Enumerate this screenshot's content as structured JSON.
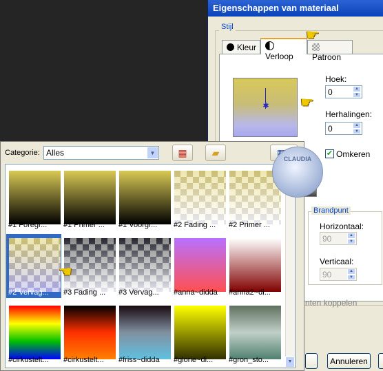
{
  "dialog": {
    "title": "Eigenschappen van materiaal",
    "stijl_label": "Stijl",
    "tabs": [
      {
        "label": "Kleur",
        "icon": "color-dot-icon"
      },
      {
        "label": "Verloop",
        "icon": "gradient-icon"
      },
      {
        "label": "Patroon",
        "icon": "pattern-icon"
      }
    ],
    "active_tab": "Verloop",
    "hoek_label": "Hoek:",
    "hoek_value": "0",
    "herhalingen_label": "Herhalingen:",
    "herhalingen_value": "0",
    "omkeren_label": "Omkeren",
    "omkeren_checked": true,
    "brandpunt_label": "Brandpunt",
    "horizontaal_label": "Horizontaal:",
    "horizontaal_value": "90",
    "verticaal_label": "Verticaal:",
    "verticaal_value": "90",
    "koppelen_label": "nten koppelen",
    "cancel_button": "Annuleren"
  },
  "picker": {
    "category_label": "Categorie:",
    "category_value": "Alles",
    "selected_index": 5,
    "gradients": [
      {
        "name": "#1 Foregr...",
        "colors": [
          "#d9c955",
          "#000000"
        ]
      },
      {
        "name": "#1 Primer ...",
        "colors": [
          "#d9c955",
          "#000000"
        ]
      },
      {
        "name": "#1 Voorgr...",
        "colors": [
          "#d9c955",
          "#000000"
        ]
      },
      {
        "name": "#2 Fading ...",
        "colors": [
          "#d9c955",
          "checker"
        ]
      },
      {
        "name": "#2 Primer ...",
        "colors": [
          "#d9c955",
          "checker"
        ]
      },
      {
        "name": "#2 Vervag...",
        "colors": [
          "#d9c955",
          "#a8a8f0"
        ]
      },
      {
        "name": "#3 Fading ...",
        "colors": [
          "#000000",
          "#ffffff"
        ]
      },
      {
        "name": "#3 Vervag...",
        "colors": [
          "#000000",
          "#ffffff"
        ]
      },
      {
        "name": "#anna~didda",
        "colors": [
          "#b870ff",
          "#ff5050"
        ]
      },
      {
        "name": "#anna2~di...",
        "colors": [
          "#ffffff",
          "#800000"
        ]
      },
      {
        "name": "#cirkustelt...",
        "colors": [
          "#ff0000",
          "#ffff00",
          "#00c000",
          "#0000ff"
        ]
      },
      {
        "name": "#cirkustelt...",
        "colors": [
          "#000000",
          "#ff3000",
          "#ff8000"
        ]
      },
      {
        "name": "#friss~didda",
        "colors": [
          "#1a0a10",
          "#8090a0",
          "#60c0e0"
        ]
      },
      {
        "name": "#glorie~di...",
        "colors": [
          "#ffff00",
          "#303000"
        ]
      },
      {
        "name": "#gron_sto...",
        "colors": [
          "#607060",
          "#c0d0c8",
          "#508070"
        ]
      }
    ]
  },
  "watermark_text": "CLAUDIA",
  "colors": {
    "title_bar": "#0a44b8",
    "selection": "#316ac5",
    "dialog_bg": "#ece9d8",
    "desktop": "#252525"
  }
}
